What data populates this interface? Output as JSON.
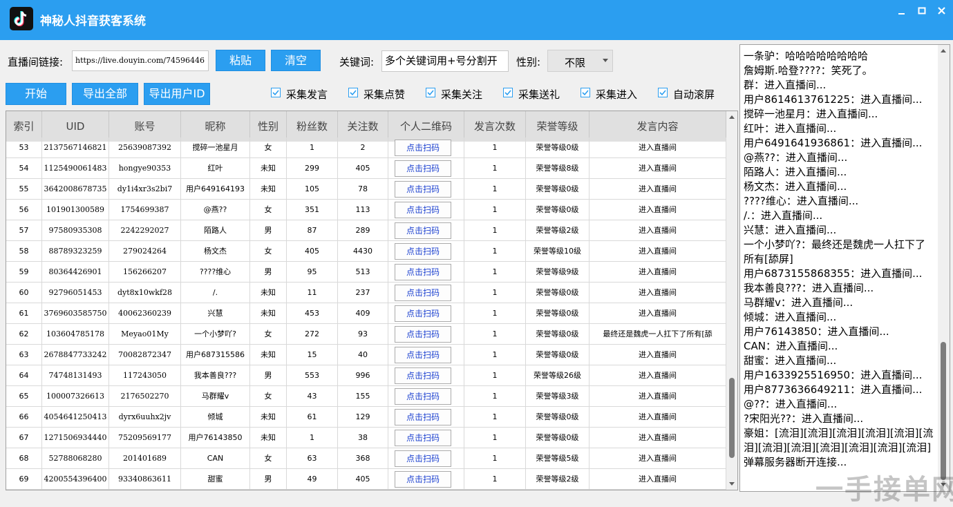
{
  "window": {
    "title": "神秘人抖音获客系统"
  },
  "toolbar": {
    "room_link_label": "直播间链接:",
    "room_link_value": "https://live.douyin.com/74596446",
    "paste_label": "粘贴",
    "clear_label": "清空",
    "keyword_label": "关键词:",
    "keyword_value": "多个关键词用+号分割开",
    "gender_label": "性别:",
    "gender_value": "不限",
    "start_label": "开始",
    "export_all_label": "导出全部",
    "export_uid_label": "导出用户ID"
  },
  "options": [
    {
      "label": "采集发言",
      "checked": true
    },
    {
      "label": "采集点赞",
      "checked": true
    },
    {
      "label": "采集关注",
      "checked": true
    },
    {
      "label": "采集送礼",
      "checked": true
    },
    {
      "label": "采集进入",
      "checked": true
    },
    {
      "label": "自动滚屏",
      "checked": true
    }
  ],
  "table": {
    "columns": [
      "索引",
      "UID",
      "账号",
      "昵称",
      "性别",
      "粉丝数",
      "关注数",
      "个人二维码",
      "发言次数",
      "荣誉等级",
      "发言内容"
    ],
    "qr_label": "点击扫码",
    "rows": [
      [
        "53",
        "2137567146821",
        "25639087392",
        "搅碎一池星月",
        "女",
        "1",
        "2",
        "1",
        "荣誉等级0级",
        "进入直播间"
      ],
      [
        "54",
        "1125490061483",
        "hongye90353",
        "红叶",
        "未知",
        "299",
        "405",
        "1",
        "荣誉等级8级",
        "进入直播间"
      ],
      [
        "55",
        "3642008678735",
        "dy1i4xr3s2bi7",
        "用户649164193",
        "未知",
        "105",
        "78",
        "1",
        "荣誉等级0级",
        "进入直播间"
      ],
      [
        "56",
        "101901300589",
        "1754699387",
        "@燕??",
        "女",
        "351",
        "113",
        "1",
        "荣誉等级0级",
        "进入直播间"
      ],
      [
        "57",
        "97580935308",
        "2242292027",
        "陌路人",
        "男",
        "87",
        "289",
        "1",
        "荣誉等级2级",
        "进入直播间"
      ],
      [
        "58",
        "88789323259",
        "279024264",
        "杨文杰",
        "女",
        "405",
        "4430",
        "1",
        "荣誉等级10级",
        "进入直播间"
      ],
      [
        "59",
        "80364426901",
        "156266207",
        "????维心",
        "男",
        "95",
        "513",
        "1",
        "荣誉等级9级",
        "进入直播间"
      ],
      [
        "60",
        "92796051453",
        "dyt8x10wkf28",
        "/.",
        "未知",
        "11",
        "237",
        "1",
        "荣誉等级0级",
        "进入直播间"
      ],
      [
        "61",
        "3769603585750",
        "40062360239",
        "兴慧",
        "未知",
        "453",
        "409",
        "1",
        "荣誉等级0级",
        "进入直播间"
      ],
      [
        "62",
        "103604785178",
        "Meyao01My",
        "一个小梦吖?",
        "女",
        "272",
        "93",
        "1",
        "荣誉等级0级",
        "最终还是魏虎一人扛下了所有[舔"
      ],
      [
        "63",
        "2678847733242",
        "70082872347",
        "用户687315586",
        "未知",
        "15",
        "40",
        "1",
        "荣誉等级0级",
        "进入直播间"
      ],
      [
        "64",
        "74748131493",
        "117243050",
        "我本善良???",
        "男",
        "553",
        "996",
        "1",
        "荣誉等级26级",
        "进入直播间"
      ],
      [
        "65",
        "100007326613",
        "2176502270",
        "马群耀v",
        "女",
        "43",
        "155",
        "1",
        "荣誉等级3级",
        "进入直播间"
      ],
      [
        "66",
        "4054641250413",
        "dyrx6uuhx2jv",
        "倾城",
        "未知",
        "61",
        "129",
        "1",
        "荣誉等级0级",
        "进入直播间"
      ],
      [
        "67",
        "1271506934440",
        "75209569177",
        "用户76143850",
        "未知",
        "1",
        "38",
        "1",
        "荣誉等级0级",
        "进入直播间"
      ],
      [
        "68",
        "52788068280",
        "201401689",
        "CAN",
        "女",
        "63",
        "368",
        "1",
        "荣誉等级5级",
        "进入直播间"
      ],
      [
        "69",
        "4200554396400",
        "93340863611",
        "甜蜜",
        "男",
        "49",
        "405",
        "1",
        "荣誉等级2级",
        "进入直播间"
      ]
    ]
  },
  "chat": {
    "lines": [
      "一条驴：哈哈哈哈哈哈哈哈",
      "詹姆斯.哈登????：笑死了。",
      "群：进入直播间...",
      "用户8614613761225：进入直播间...",
      "搅碎一池星月：进入直播间...",
      "红叶：进入直播间...",
      "用户6491641936861：进入直播间...",
      "@燕??：进入直播间...",
      "陌路人：进入直播间...",
      "杨文杰：进入直播间...",
      "????维心：进入直播间...",
      "/.：进入直播间...",
      "兴慧：进入直播间...",
      "一个小梦吖?：最终还是魏虎一人扛下了",
      "所有[舔屏]",
      "用户6873155868355：进入直播间...",
      "我本善良???：进入直播间...",
      "马群耀v：进入直播间...",
      "倾城：进入直播间...",
      "用户76143850：进入直播间...",
      "CAN：进入直播间...",
      "甜蜜：进入直播间...",
      "用户1633925516950：进入直播间...",
      "用户8773636649211：进入直播间...",
      "@??：进入直播间...",
      "?宋阳光??：进入直播间...",
      "豪姐：[流泪][流泪][流泪][流泪][流泪][流",
      "泪][流泪][流泪][流泪][流泪][流泪][流泪]",
      "弹幕服务器断开连接..."
    ]
  },
  "watermark": "一手接单网"
}
